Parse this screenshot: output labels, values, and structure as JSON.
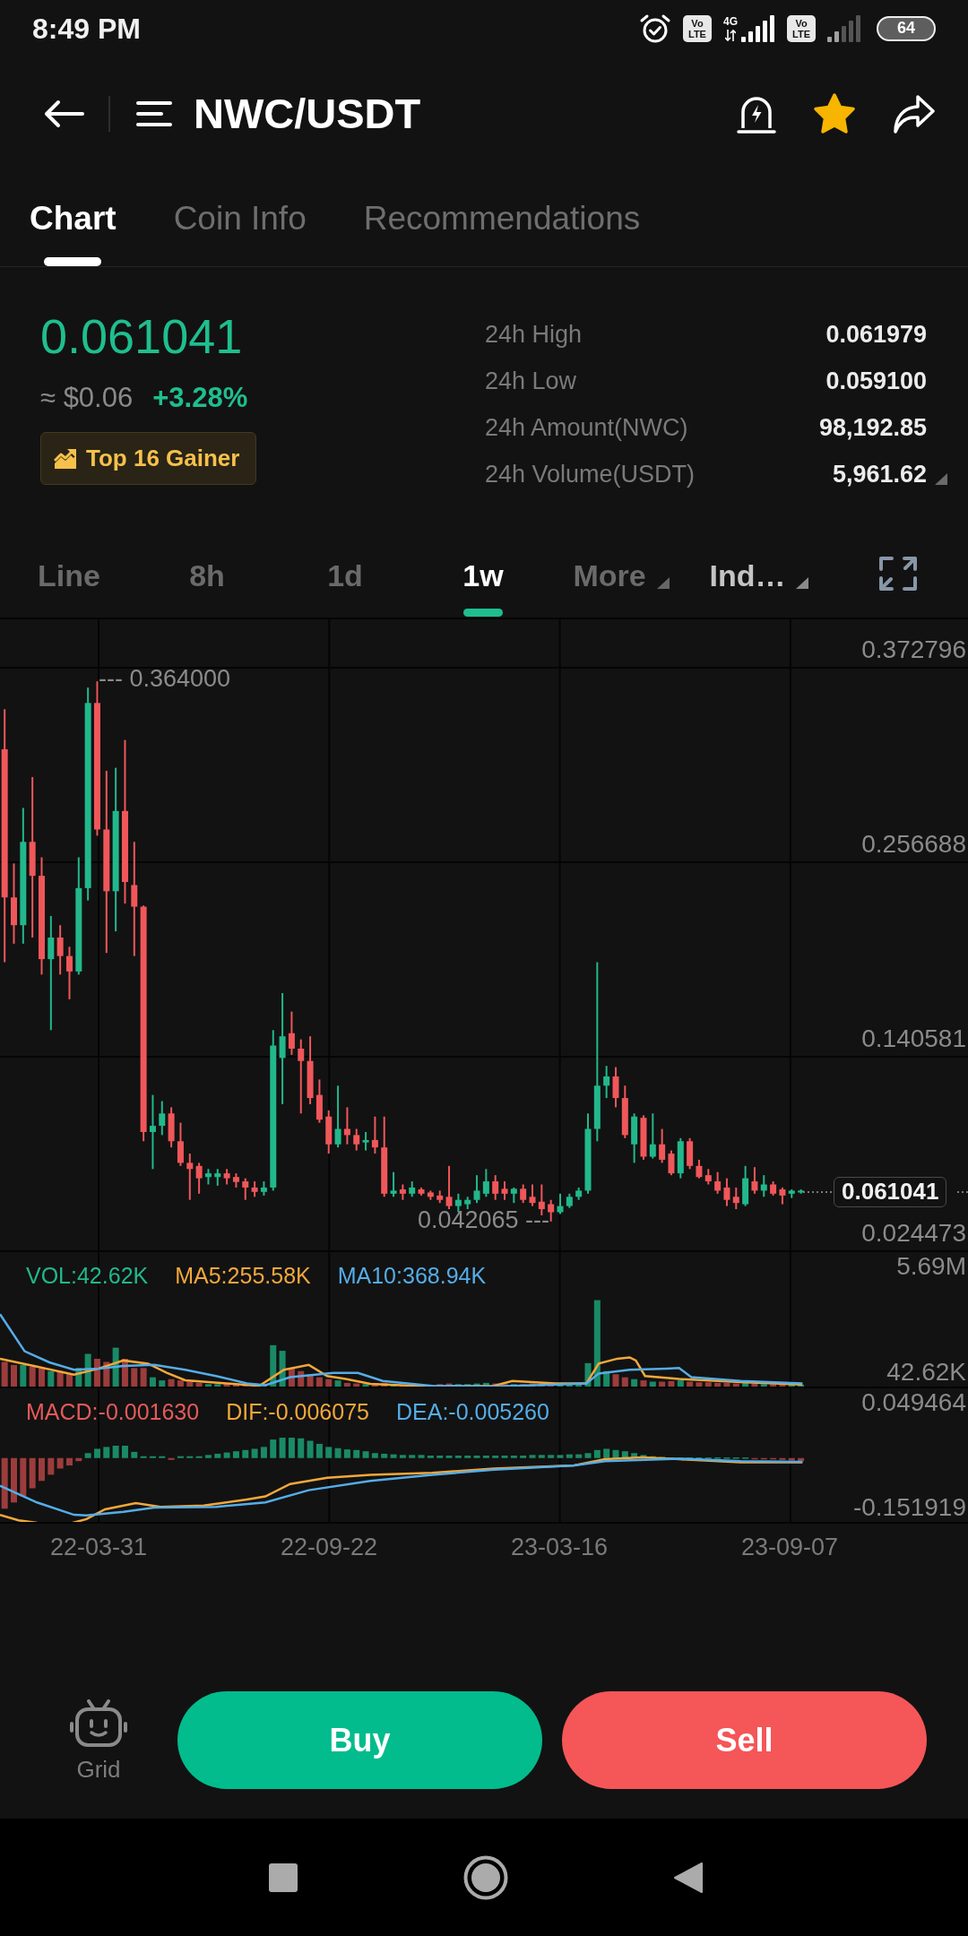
{
  "status_bar": {
    "time": "8:49 PM",
    "sims": [
      {
        "badge_top": "Vo",
        "badge_bottom": "LTE",
        "network": "4G"
      },
      {
        "badge_top": "Vo",
        "badge_bottom": "LTE"
      }
    ],
    "battery": "64"
  },
  "header": {
    "title": "NWC/USDT",
    "favorited": true
  },
  "tabs": [
    {
      "label": "Chart",
      "selected": true
    },
    {
      "label": "Coin Info",
      "selected": false
    },
    {
      "label": "Recommendations",
      "selected": false
    }
  ],
  "ticker": {
    "price": "0.061041",
    "fiat_price": "≈ $0.06",
    "change": "+3.28%",
    "badge": "Top 16 Gainer",
    "stats": [
      {
        "label": "24h High",
        "value": "0.061979",
        "expandable": false
      },
      {
        "label": "24h Low",
        "value": "0.059100",
        "expandable": false
      },
      {
        "label": "24h Amount(NWC)",
        "value": "98,192.85",
        "expandable": false
      },
      {
        "label": "24h Volume(USDT)",
        "value": "5,961.62",
        "expandable": true
      }
    ]
  },
  "timeframe": {
    "intervals": [
      {
        "label": "Line",
        "selected": false
      },
      {
        "label": "8h",
        "selected": false
      },
      {
        "label": "1d",
        "selected": false
      },
      {
        "label": "1w",
        "selected": true
      }
    ],
    "menus": [
      {
        "label": "More",
        "active": false
      },
      {
        "label": "Ind…",
        "active": true
      }
    ]
  },
  "chart": {
    "price_axis": [
      "0.372796",
      "0.256688",
      "0.140581",
      "0.024473"
    ],
    "high_label": "--- 0.364000",
    "low_label": "0.042065 ---",
    "last_price": "0.061041",
    "volume": {
      "legend": [
        {
          "label": "VOL:42.62K",
          "color": "#22b88b",
          "kind": "bars"
        },
        {
          "label": "MA5:255.58K",
          "color": "#f3a83b",
          "kind": "line"
        },
        {
          "label": "MA10:368.94K",
          "color": "#55ade8",
          "kind": "line"
        }
      ],
      "axis": [
        "5.69M",
        "42.62K"
      ]
    },
    "macd": {
      "legend": [
        {
          "label": "MACD:-0.001630",
          "color": "#e65a5a",
          "kind": "bars"
        },
        {
          "label": "DIF:-0.006075",
          "color": "#f3a83b",
          "kind": "line"
        },
        {
          "label": "DEA:-0.005260",
          "color": "#55ade8",
          "kind": "line"
        }
      ],
      "axis": [
        "0.049464",
        "-0.151919"
      ]
    },
    "dates": [
      "22-03-31",
      "22-09-22",
      "23-03-16",
      "23-09-07"
    ]
  },
  "actions": {
    "grid_label": "Grid",
    "buttons": [
      {
        "label": "Buy",
        "kind": "buy"
      },
      {
        "label": "Sell",
        "kind": "sell"
      }
    ]
  }
}
